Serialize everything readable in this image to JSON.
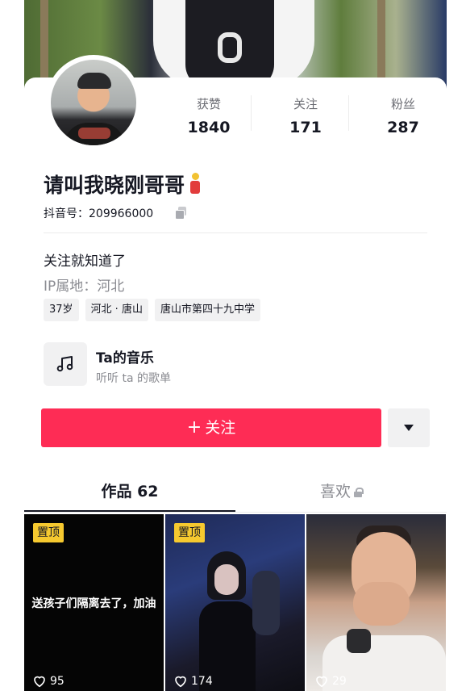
{
  "profile": {
    "nickname": "请叫我晓刚哥哥",
    "douyin_id": "抖音号：209966000",
    "bio": "关注就知道了",
    "ip_location": "IP属地：河北",
    "tags": [
      "37岁",
      "河北 · 唐山",
      "唐山市第四十九中学"
    ]
  },
  "stats": {
    "likes_label": "获赞",
    "likes_value": "1840",
    "following_label": "关注",
    "following_value": "171",
    "followers_label": "粉丝",
    "followers_value": "287"
  },
  "music": {
    "title": "Ta的音乐",
    "subtitle": "听听 ta 的歌单"
  },
  "actions": {
    "follow_label": "关注"
  },
  "tabs": {
    "works_label": "作品 62",
    "likes_label": "喜欢"
  },
  "videos": [
    {
      "pinned_label": "置顶",
      "caption": "送孩子们隔离去了，加油",
      "likes": "95"
    },
    {
      "pinned_label": "置顶",
      "caption": "",
      "likes": "174"
    },
    {
      "pinned_label": "",
      "caption": "",
      "likes": "29"
    }
  ],
  "colors": {
    "follow_button": "#fe2c55",
    "pin_badge": "#f6c92f",
    "text_primary": "#161823",
    "text_secondary": "#8a8b91"
  },
  "icons": [
    "copy-icon",
    "music-note-icon",
    "plus-icon",
    "dropdown-arrow-icon",
    "lock-icon",
    "heart-icon"
  ]
}
